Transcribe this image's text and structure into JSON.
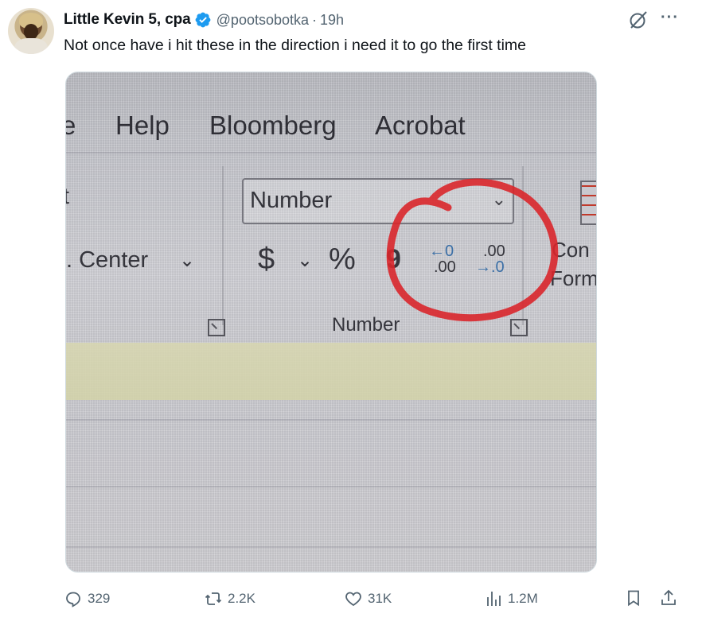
{
  "tweet": {
    "author_name": "Little Kevin 5, cpa",
    "handle": "@pootsobotka",
    "separator": "·",
    "time": "19h",
    "text": "Not once have i hit these in the direction i need it to go the first time",
    "more_label": "···"
  },
  "media": {
    "tabs": [
      "e",
      "Help",
      "Bloomberg",
      "Acrobat"
    ],
    "left_clip_text": "t",
    "merge_text": ". Center",
    "number_format_value": "Number",
    "currency_symbol": "$",
    "percent_symbol": "%",
    "comma_symbol": "9",
    "decrease_decimal_top": "←0",
    "decrease_decimal_bottom": ".00",
    "increase_decimal_top": ".00",
    "increase_decimal_bottom": "→.0",
    "group_label": "Number",
    "cond_format_line1": "Con",
    "cond_format_line2": "Form",
    "highlight_color": "#d9262b"
  },
  "actions": {
    "replies": "329",
    "reposts": "2.2K",
    "likes": "31K",
    "views": "1.2M"
  },
  "colors": {
    "verified": "#1d9bf0",
    "muted": "#536471"
  }
}
